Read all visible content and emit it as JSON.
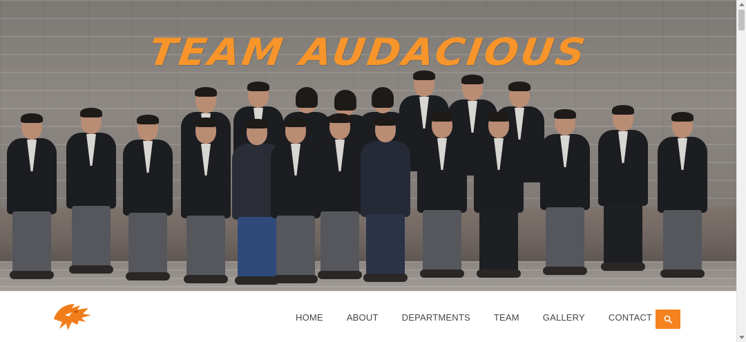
{
  "hero": {
    "title": "TEAM AUDACIOUS",
    "title_color": "#f7952a"
  },
  "navbar": {
    "logo_icon": "tiger-head-logo-icon",
    "items": [
      {
        "label": "HOME"
      },
      {
        "label": "ABOUT"
      },
      {
        "label": "DEPARTMENTS"
      },
      {
        "label": "TEAM"
      },
      {
        "label": "GALLERY"
      },
      {
        "label": "CONTACT"
      }
    ],
    "search_icon": "search-icon",
    "accent_color": "#f58220"
  }
}
